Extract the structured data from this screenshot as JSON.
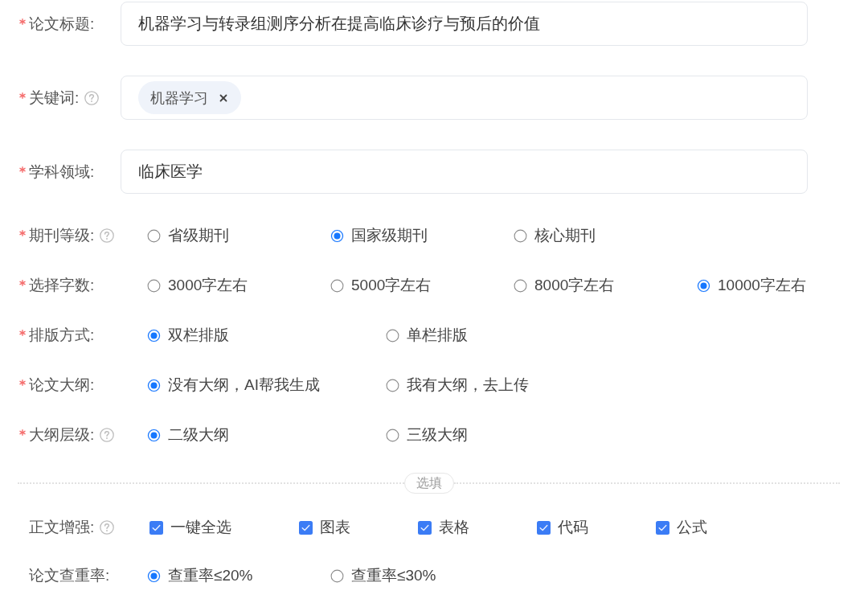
{
  "fields": [
    {
      "kind": "text",
      "label": "论文标题:",
      "required": true,
      "help": false,
      "value": "机器学习与转录组测序分析在提高临床诊疗与预后的价值"
    },
    {
      "kind": "tags",
      "label": "关键词:",
      "required": true,
      "help": true,
      "tags": [
        {
          "label": "机器学习"
        }
      ]
    },
    {
      "kind": "text",
      "label": "学科领域:",
      "required": true,
      "help": false,
      "value": "临床医学"
    },
    {
      "kind": "radio",
      "label": "期刊等级:",
      "required": true,
      "help": true,
      "options": [
        {
          "label": "省级期刊",
          "selected": false
        },
        {
          "label": "国家级期刊",
          "selected": true
        },
        {
          "label": "核心期刊",
          "selected": false
        }
      ]
    },
    {
      "kind": "radio",
      "label": "选择字数:",
      "required": true,
      "help": false,
      "options": [
        {
          "label": "3000字左右",
          "selected": false
        },
        {
          "label": "5000字左右",
          "selected": false
        },
        {
          "label": "8000字左右",
          "selected": false
        },
        {
          "label": "10000字左右",
          "selected": true
        }
      ]
    },
    {
      "kind": "radio",
      "label": "排版方式:",
      "required": true,
      "help": false,
      "options": [
        {
          "label": "双栏排版",
          "selected": true
        },
        {
          "label": "单栏排版",
          "selected": false
        }
      ]
    },
    {
      "kind": "radio",
      "label": "论文大纲:",
      "required": true,
      "help": false,
      "options": [
        {
          "label": "没有大纲，AI帮我生成",
          "selected": true
        },
        {
          "label": "我有大纲，去上传",
          "selected": false
        }
      ]
    },
    {
      "kind": "radio",
      "label": "大纲层级:",
      "required": true,
      "help": true,
      "options": [
        {
          "label": "二级大纲",
          "selected": true
        },
        {
          "label": "三级大纲",
          "selected": false
        }
      ]
    }
  ],
  "divider": {
    "label": "选填"
  },
  "optional_fields": [
    {
      "kind": "checkbox",
      "label": "正文增强:",
      "required": false,
      "help": true,
      "options": [
        {
          "label": "一键全选",
          "checked": true
        },
        {
          "label": "图表",
          "checked": true
        },
        {
          "label": "表格",
          "checked": true
        },
        {
          "label": "代码",
          "checked": true
        },
        {
          "label": "公式",
          "checked": true
        }
      ]
    },
    {
      "kind": "radio",
      "label": "论文查重率:",
      "required": false,
      "help": false,
      "options": [
        {
          "label": "查重率≤20%",
          "selected": true
        },
        {
          "label": "查重率≤30%",
          "selected": false
        }
      ]
    }
  ]
}
